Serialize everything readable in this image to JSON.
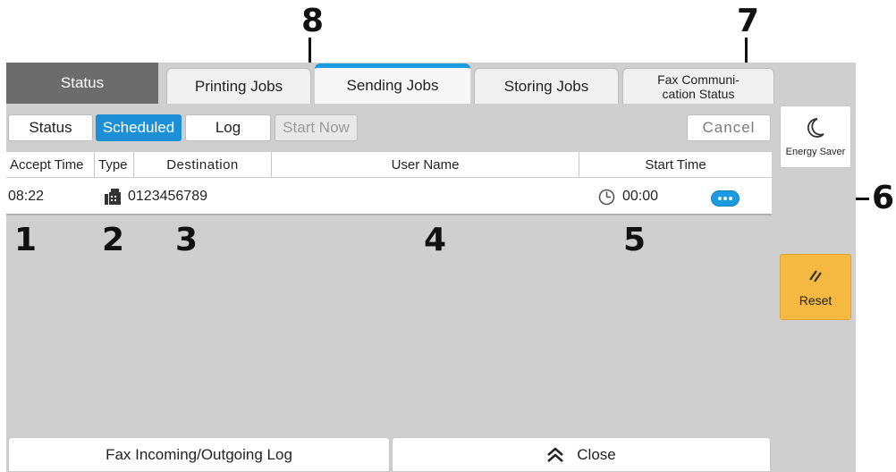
{
  "callouts": [
    "1",
    "2",
    "3",
    "4",
    "5",
    "6",
    "7",
    "8"
  ],
  "tabs": [
    {
      "label": "Status"
    },
    {
      "label": "Printing Jobs"
    },
    {
      "label": "Sending Jobs"
    },
    {
      "label": "Storing Jobs"
    },
    {
      "label_line1": "Fax Communi-",
      "label_line2": "cation Status"
    }
  ],
  "filters": {
    "status": "Status",
    "scheduled": "Scheduled",
    "log": "Log",
    "start_now": "Start Now",
    "cancel": "Cancel"
  },
  "columns": [
    "Accept Time",
    "Type",
    "Destination",
    "User Name",
    "Start Time"
  ],
  "job": {
    "accept_time": "08:22",
    "type_icon": "fax-icon",
    "destination": "0123456789",
    "user_name": "",
    "start_time": "00:00"
  },
  "bottom": {
    "fax_log": "Fax Incoming/Outgoing Log",
    "close": "Close"
  },
  "side": {
    "energy_saver": "Energy Saver",
    "reset": "Reset"
  },
  "colors": {
    "accent": "#1d8fd6",
    "status_tab": "#6c6c6c",
    "reset": "#f5b942",
    "background": "#cfcfcf"
  }
}
